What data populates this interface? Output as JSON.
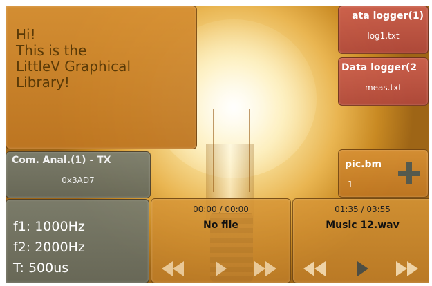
{
  "hello": {
    "text": "Hi!\nThis is the\nLittleV Graphical\nLibrary!"
  },
  "logger1": {
    "title": "ata logger(1)",
    "file": "log1.txt"
  },
  "logger2": {
    "title": "Data logger(2",
    "file": "meas.txt"
  },
  "com": {
    "title": "Com. Anal.(1) - TX",
    "value": "0x3AD7"
  },
  "pic": {
    "title": "pic.bm",
    "number": "1"
  },
  "freq": {
    "f1": "f1: 1000Hz",
    "f2": "f2: 2000Hz",
    "t": "T: 500us"
  },
  "player1": {
    "time": "00:00 / 00:00",
    "name": "No file"
  },
  "player2": {
    "time": "01:35 / 03:55",
    "name": "Music 12.wav"
  },
  "icons": [
    "rewind-icon",
    "play-icon",
    "fast-forward-icon",
    "plus-icon"
  ],
  "colors": {
    "tile_orange": "#d69034",
    "tile_red": "#cd5f50",
    "tile_grey": "#787d70",
    "bulb_glow": "#fbe7a6"
  }
}
